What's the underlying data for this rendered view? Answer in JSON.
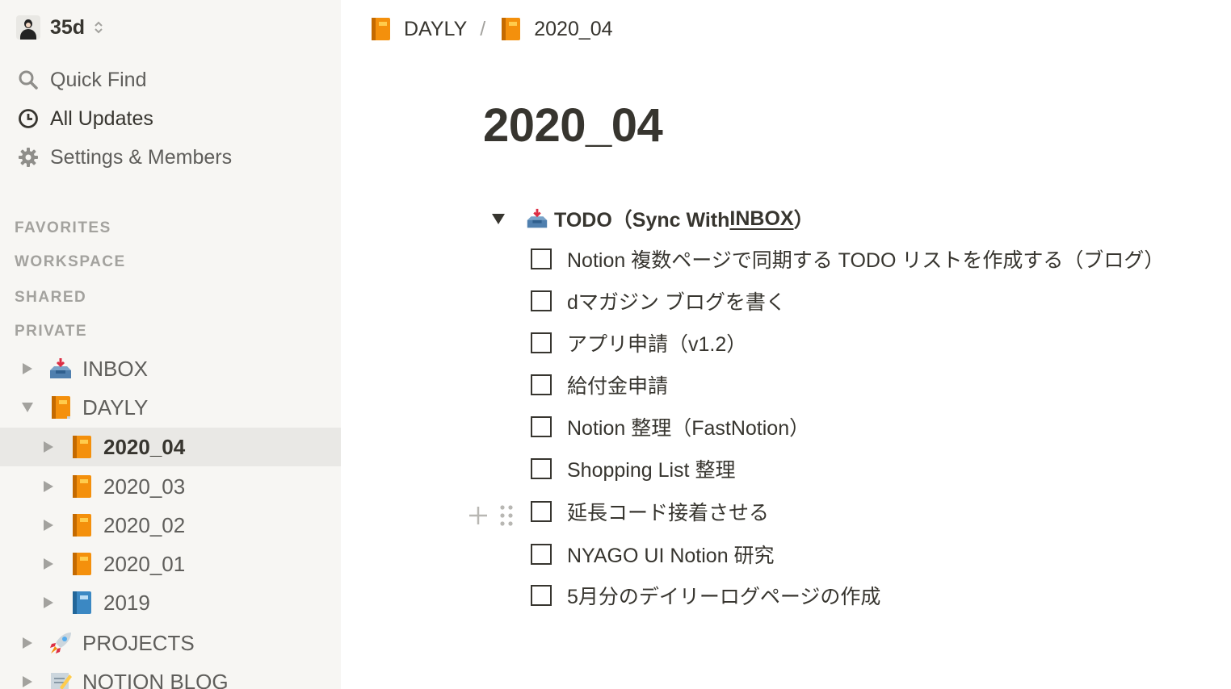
{
  "workspace": {
    "name": "35d"
  },
  "sidebar": {
    "nav": [
      {
        "label": "Quick Find",
        "icon": "search-icon"
      },
      {
        "label": "All Updates",
        "icon": "clock-icon"
      },
      {
        "label": "Settings & Members",
        "icon": "gear-icon"
      }
    ],
    "sections": [
      "FAVORITES",
      "WORKSPACE",
      "SHARED",
      "PRIVATE"
    ],
    "tree": [
      {
        "label": "INBOX",
        "icon": "inbox-tray-icon",
        "expanded": false,
        "selected": false
      },
      {
        "label": "DAYLY",
        "icon": "orange-book-icon",
        "expanded": true,
        "selected": false
      },
      {
        "label": "2020_04",
        "icon": "orange-book-icon",
        "expanded": false,
        "selected": true
      },
      {
        "label": "2020_03",
        "icon": "orange-book-icon",
        "expanded": false,
        "selected": false
      },
      {
        "label": "2020_02",
        "icon": "orange-book-icon",
        "expanded": false,
        "selected": false
      },
      {
        "label": "2020_01",
        "icon": "orange-book-icon",
        "expanded": false,
        "selected": false
      },
      {
        "label": "2019",
        "icon": "blue-book-icon",
        "expanded": false,
        "selected": false
      },
      {
        "label": "PROJECTS",
        "icon": "rocket-icon",
        "expanded": false,
        "selected": false
      },
      {
        "label": "NOTION BLOG",
        "icon": "memo-icon",
        "expanded": false,
        "selected": false
      }
    ]
  },
  "breadcrumb": [
    {
      "label": "DAYLY",
      "icon": "orange-book-icon"
    },
    {
      "label": "2020_04",
      "icon": "orange-book-icon"
    }
  ],
  "breadcrumb_separator": "/",
  "page": {
    "title": "2020_04",
    "toggle": {
      "icon": "inbox-tray-icon",
      "prefix": "TODO（Sync With ",
      "link": "INBOX",
      "suffix": "）"
    },
    "todos": [
      {
        "text": "Notion 複数ページで同期する TODO リストを作成する（ブログ）",
        "checked": false
      },
      {
        "text": "dマガジン ブログを書く",
        "checked": false
      },
      {
        "text": "アプリ申請（v1.2）",
        "checked": false
      },
      {
        "text": "給付金申請",
        "checked": false
      },
      {
        "text": "Notion 整理（FastNotion）",
        "checked": false
      },
      {
        "text": "Shopping List 整理",
        "checked": false
      },
      {
        "text": "延長コード接着させる",
        "checked": false
      },
      {
        "text": "NYAGO UI Notion 研究",
        "checked": false
      },
      {
        "text": "5月分のデイリーログページの作成",
        "checked": false
      }
    ]
  },
  "colors": {
    "sidebar_bg": "#f7f6f3",
    "selected_bg": "#e9e8e5",
    "text": "#37352f",
    "muted": "#a3a29e",
    "book_orange": "#f4900c",
    "book_blue": "#3b88c3"
  }
}
